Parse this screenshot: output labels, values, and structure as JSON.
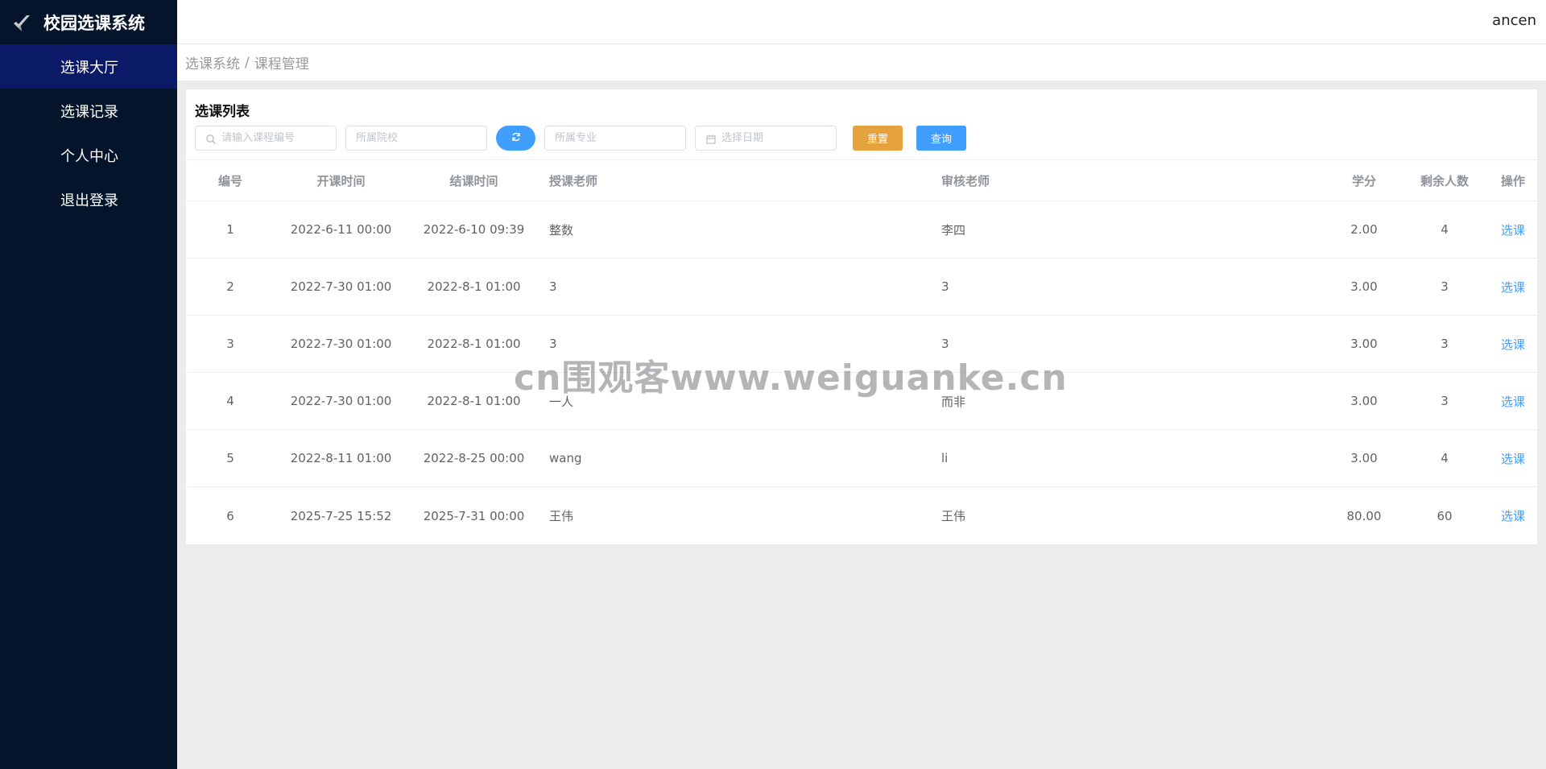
{
  "sidebar": {
    "brand_title": "校园选课系统",
    "brand_icon": "check-icon",
    "items": [
      {
        "label": "选课大厅",
        "active": true
      },
      {
        "label": "选课记录",
        "active": false
      },
      {
        "label": "个人中心",
        "active": false
      },
      {
        "label": "退出登录",
        "active": false
      }
    ]
  },
  "header": {
    "user": "ancen"
  },
  "breadcrumb": {
    "root": "选课系统",
    "sep": "/",
    "current": "课程管理"
  },
  "card": {
    "title": "选课列表"
  },
  "filters": {
    "course_code_placeholder": "请输入课程编号",
    "college_placeholder": "所属院校",
    "major_placeholder": "所属专业",
    "date_placeholder": "选择日期",
    "reset_label": "重置",
    "query_label": "查询"
  },
  "table": {
    "headers": {
      "id": "编号",
      "start": "开课时间",
      "end": "结课时间",
      "teacher": "授课老师",
      "auditor": "审核老师",
      "credit": "学分",
      "remain": "剩余人数",
      "op": "操作"
    },
    "rows": [
      {
        "id": "1",
        "start": "2022-6-11 00:00",
        "end": "2022-6-10 09:39",
        "teacher": "整数",
        "auditor": "李四",
        "credit": "2.00",
        "remain": "4",
        "op": "选课"
      },
      {
        "id": "2",
        "start": "2022-7-30 01:00",
        "end": "2022-8-1 01:00",
        "teacher": "3",
        "auditor": "3",
        "credit": "3.00",
        "remain": "3",
        "op": "选课"
      },
      {
        "id": "3",
        "start": "2022-7-30 01:00",
        "end": "2022-8-1 01:00",
        "teacher": "3",
        "auditor": "3",
        "credit": "3.00",
        "remain": "3",
        "op": "选课"
      },
      {
        "id": "4",
        "start": "2022-7-30 01:00",
        "end": "2022-8-1 01:00",
        "teacher": "一人",
        "auditor": "而非",
        "credit": "3.00",
        "remain": "3",
        "op": "选课"
      },
      {
        "id": "5",
        "start": "2022-8-11 01:00",
        "end": "2022-8-25 00:00",
        "teacher": "wang",
        "auditor": "li",
        "credit": "3.00",
        "remain": "4",
        "op": "选课"
      },
      {
        "id": "6",
        "start": "2025-7-25 15:52",
        "end": "2025-7-31 00:00",
        "teacher": "王伟",
        "auditor": "王伟",
        "credit": "80.00",
        "remain": "60",
        "op": "选课"
      }
    ]
  },
  "watermark": "cn围观客www.weiguanke.cn",
  "colors": {
    "sidebar_bg": "#04142b",
    "sidebar_active": "#0a1a66",
    "primary": "#409eff",
    "warning": "#e6a23c"
  }
}
